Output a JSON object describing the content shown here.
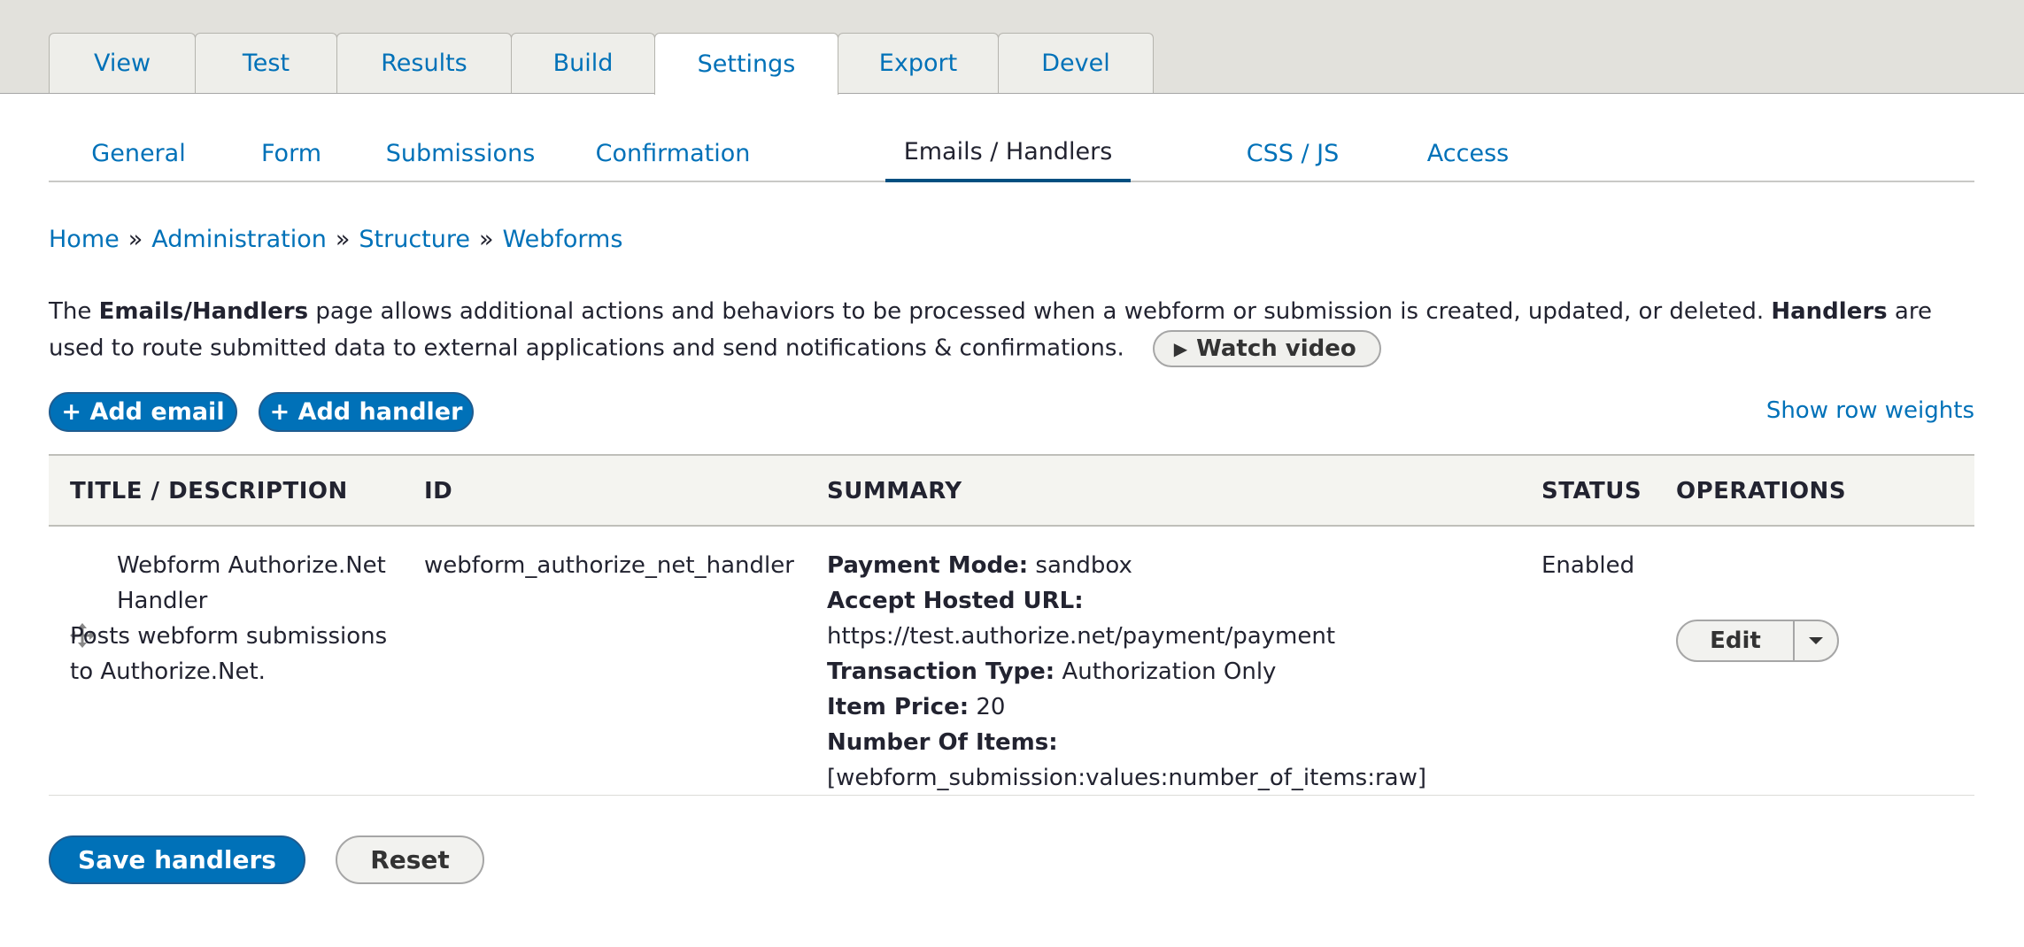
{
  "primary_tabs": [
    {
      "label": "View"
    },
    {
      "label": "Test"
    },
    {
      "label": "Results"
    },
    {
      "label": "Build"
    },
    {
      "label": "Settings",
      "active": true
    },
    {
      "label": "Export"
    },
    {
      "label": "Devel"
    }
  ],
  "secondary_tabs": [
    {
      "label": "General"
    },
    {
      "label": "Form"
    },
    {
      "label": "Submissions"
    },
    {
      "label": "Confirmation"
    },
    {
      "label": "Emails / Handlers",
      "active": true
    },
    {
      "label": "CSS / JS"
    },
    {
      "label": "Access"
    }
  ],
  "breadcrumb": {
    "items": [
      "Home",
      "Administration",
      "Structure",
      "Webforms"
    ],
    "separator": "»"
  },
  "description": {
    "part1": "The ",
    "bold1": "Emails/Handlers",
    "part2": " page allows additional actions and behaviors to be processed when a webform or submission is created, updated, or deleted. ",
    "bold2": "Handlers",
    "part3": " are used to route submitted data to external applications and send notifications & confirmations.",
    "watch_video_label": "Watch video"
  },
  "actions": {
    "add_email": "+ Add email",
    "add_handler": "+ Add handler",
    "show_row_weights": "Show row weights"
  },
  "table": {
    "headers": {
      "title": "TITLE / DESCRIPTION",
      "id": "ID",
      "summary": "SUMMARY",
      "status": "STATUS",
      "operations": "OPERATIONS"
    },
    "rows": [
      {
        "title": "Webform Authorize.Net Handler",
        "description": "Posts webform submissions to Authorize.Net.",
        "id": "webform_authorize_net_handler",
        "summary": {
          "payment_mode_label": "Payment Mode:",
          "payment_mode": "sandbox",
          "accept_url_label": "Accept Hosted URL:",
          "accept_url": "https://test.authorize.net/payment/payment",
          "transaction_type_label": "Transaction Type:",
          "transaction_type": "Authorization Only",
          "item_price_label": "Item Price:",
          "item_price": "20",
          "number_items_label": "Number Of Items:",
          "number_items": "[webform_submission:values:number_of_items:raw]"
        },
        "status": "Enabled",
        "edit_label": "Edit"
      }
    ]
  },
  "footer": {
    "save_label": "Save handlers",
    "reset_label": "Reset"
  },
  "colors": {
    "link": "#0071b8",
    "primary_button": "#0071b8",
    "tab_bar_bg": "#e2e1dc",
    "table_header_bg": "#f4f4f0"
  }
}
